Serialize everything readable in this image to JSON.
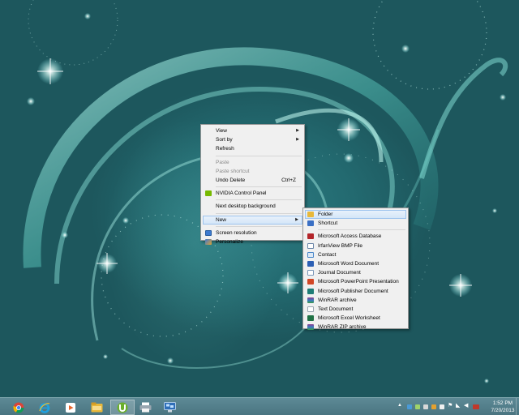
{
  "desktop": {
    "context_menu": {
      "items": [
        {
          "label": "View",
          "has_submenu": true
        },
        {
          "label": "Sort by",
          "has_submenu": true
        },
        {
          "label": "Refresh"
        },
        {
          "label": "Paste",
          "disabled": true
        },
        {
          "label": "Paste shortcut",
          "disabled": true
        },
        {
          "label": "Undo Delete",
          "shortcut": "Ctrl+Z"
        },
        {
          "label": "NVIDIA Control Panel",
          "icon": "nvidia-icon"
        },
        {
          "label": "Next desktop background"
        },
        {
          "label": "New",
          "has_submenu": true,
          "highlighted": true
        },
        {
          "label": "Screen resolution",
          "icon": "display-icon"
        },
        {
          "label": "Personalize",
          "icon": "personalize-icon"
        }
      ]
    },
    "new_submenu": {
      "items": [
        {
          "label": "Folder",
          "icon": "folder-icon",
          "color": "#e8b83a"
        },
        {
          "label": "Shortcut",
          "icon": "shortcut-icon",
          "color": "#3a6fc4"
        },
        {
          "label": "Microsoft Access Database",
          "icon": "access-icon",
          "color": "#b3252a"
        },
        {
          "label": "IrfanView BMP File",
          "icon": "bmp-icon",
          "color": "#6b86a8"
        },
        {
          "label": "Contact",
          "icon": "contact-icon",
          "color": "#4a87c9"
        },
        {
          "label": "Microsoft Word Document",
          "icon": "word-icon",
          "color": "#2b5fb4"
        },
        {
          "label": "Journal Document",
          "icon": "journal-icon",
          "color": "#7a96b8"
        },
        {
          "label": "Microsoft PowerPoint Presentation",
          "icon": "powerpoint-icon",
          "color": "#d24726"
        },
        {
          "label": "Microsoft Publisher Document",
          "icon": "publisher-icon",
          "color": "#1f7c76"
        },
        {
          "label": "WinRAR archive",
          "icon": "winrar-icon",
          "color": "#8a3c8e"
        },
        {
          "label": "Text Document",
          "icon": "text-icon",
          "color": "#9aa5b1"
        },
        {
          "label": "Microsoft Excel Worksheet",
          "icon": "excel-icon",
          "color": "#207245"
        },
        {
          "label": "WinRAR ZIP archive",
          "icon": "winrar-zip-icon",
          "color": "#8a3c8e"
        }
      ]
    }
  },
  "taskbar": {
    "apps": [
      {
        "name": "chrome-icon"
      },
      {
        "name": "internet-explorer-icon"
      },
      {
        "name": "media-player-icon"
      },
      {
        "name": "file-explorer-icon"
      },
      {
        "name": "utorrent-icon",
        "active": true
      },
      {
        "name": "printer-icon"
      },
      {
        "name": "remote-desktop-icon"
      }
    ],
    "tray_icons": [
      "show-hidden-icon",
      "network-app-icon",
      "power-icon",
      "shield-icon",
      "antivirus-icon",
      "flag-icon",
      "wifi-icon",
      "sound-icon",
      "language-icon"
    ],
    "clock": {
      "time": "1:52 PM",
      "date": "7/20/2013"
    }
  },
  "colors": {
    "desktop_teal": "#236a70",
    "taskbar": "#4f7c88",
    "highlight_border": "#9ec4ee"
  }
}
